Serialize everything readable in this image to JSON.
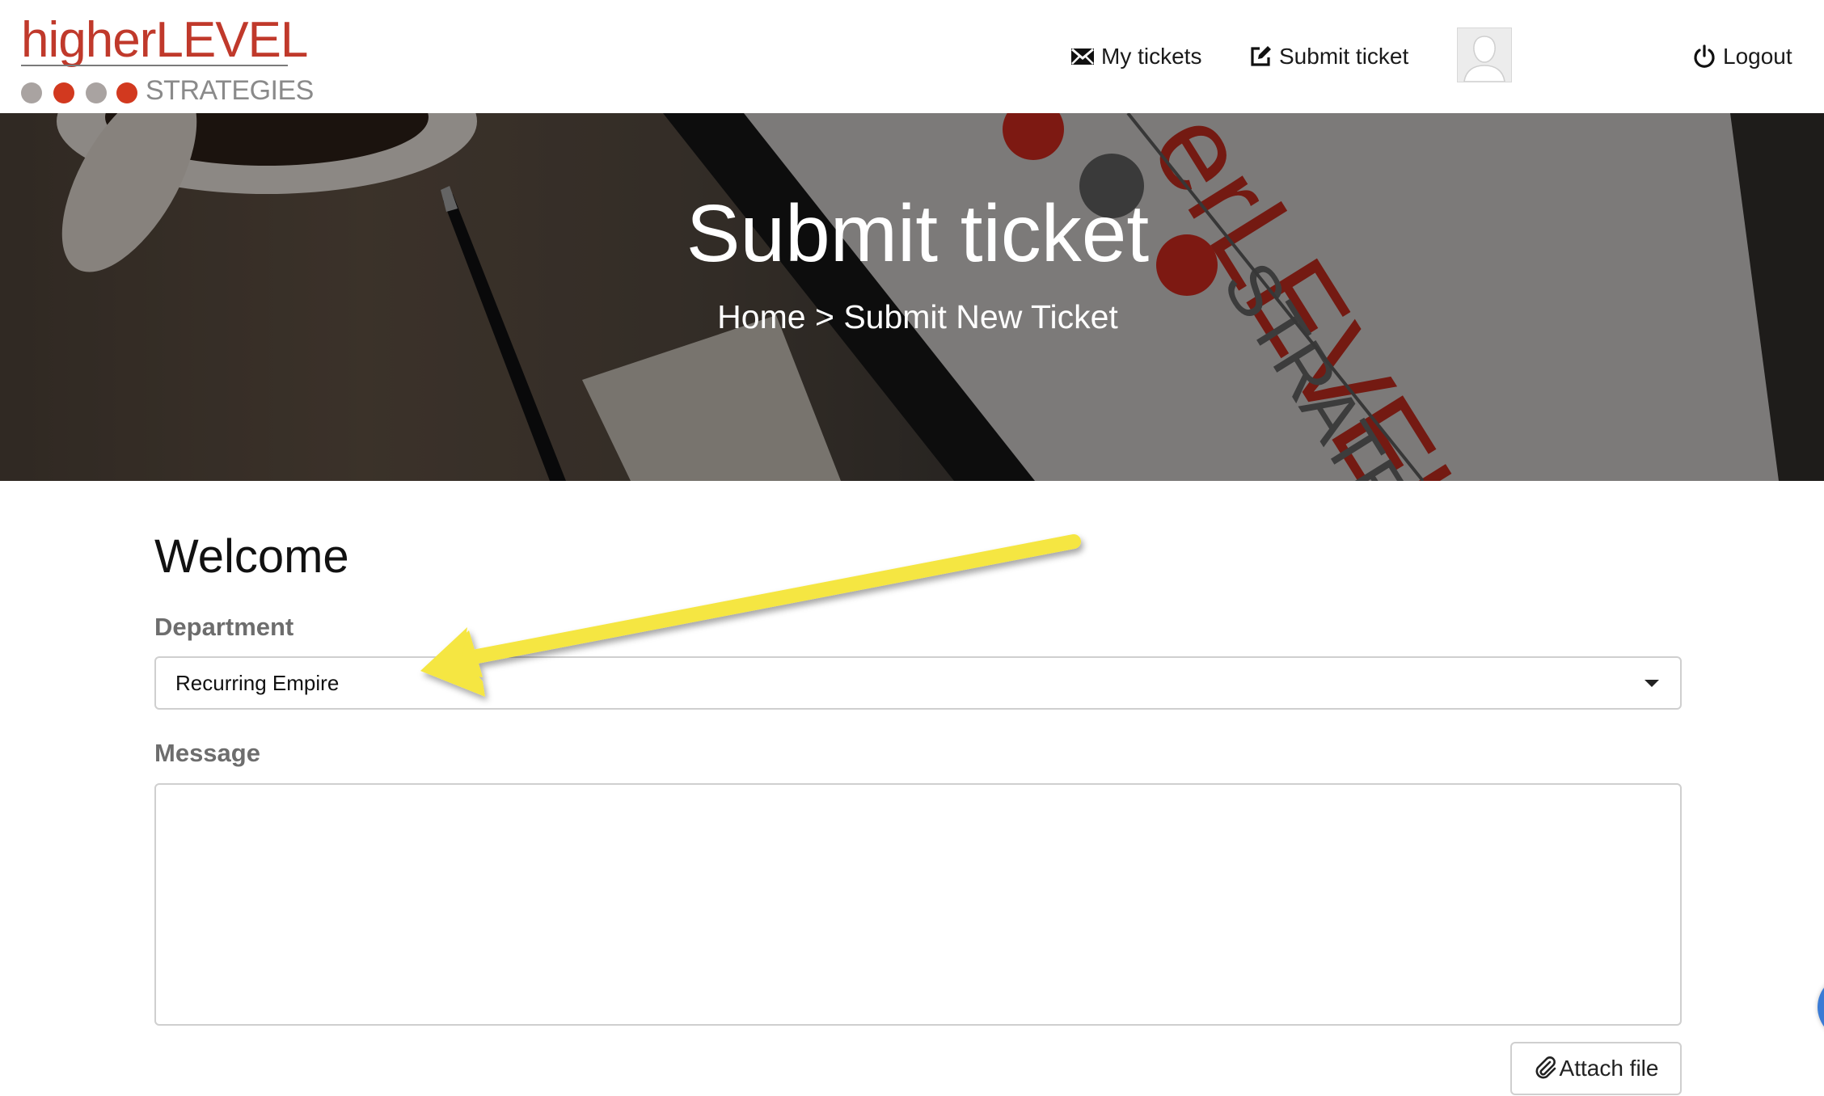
{
  "brand": {
    "name_part1": "higher",
    "name_part2": "LEVEL",
    "tagline": "STRATEGIES",
    "colors": {
      "red": "#c0392b",
      "grey": "#9e9e9e"
    }
  },
  "nav": {
    "my_tickets": "My tickets",
    "submit_ticket": "Submit ticket",
    "logout": "Logout",
    "icons": {
      "my_tickets": "envelope-icon",
      "submit_ticket": "edit-icon",
      "logout": "power-icon"
    }
  },
  "hero": {
    "title": "Submit ticket",
    "breadcrumb_home": "Home",
    "breadcrumb_sep": ">",
    "breadcrumb_current": "Submit New Ticket"
  },
  "form": {
    "heading": "Welcome",
    "department_label": "Department",
    "department_value": "Recurring Empire",
    "message_label": "Message",
    "message_value": "",
    "attach_label": "Attach file"
  },
  "annotation": {
    "arrow_color": "#f5e642"
  }
}
